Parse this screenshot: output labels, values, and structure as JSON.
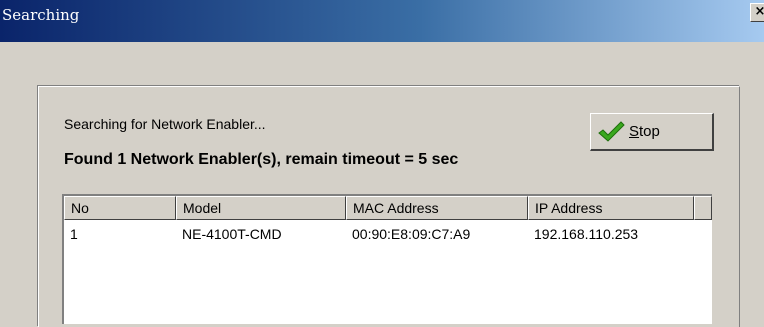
{
  "window": {
    "title": "Searching",
    "close_label": "×"
  },
  "status": {
    "searching_text": "Searching for Network Enabler...",
    "found_text": "Found 1 Network Enabler(s), remain timeout = 5 sec"
  },
  "stop_button": {
    "mnemonic": "S",
    "rest": "top",
    "icon": "checkmark-icon",
    "icon_color": "#3aa81e"
  },
  "table": {
    "columns": [
      "No",
      "Model",
      "MAC Address",
      "IP Address"
    ],
    "rows": [
      [
        "1",
        "NE-4100T-CMD",
        "00:90:E8:09:C7:A9",
        "192.168.110.253"
      ]
    ]
  }
}
